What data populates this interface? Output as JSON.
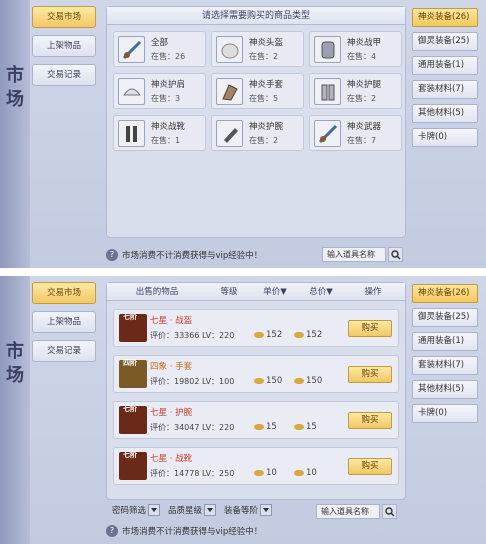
{
  "side_title": [
    "市",
    "场"
  ],
  "nav": [
    "交易市场",
    "上架物品",
    "交易记录"
  ],
  "categories": [
    "神炎装备(26)",
    "御灵装备(25)",
    "通用装备(1)",
    "套装材料(7)",
    "其他材料(5)",
    "卡牌(0)"
  ],
  "top": {
    "header": "请选择需要购买的商品类型",
    "items": [
      {
        "name": "全部",
        "stock": "在售：26"
      },
      {
        "name": "神炎头盔",
        "stock": "在售：2"
      },
      {
        "name": "神炎战甲",
        "stock": "在售：4"
      },
      {
        "name": "神炎护肩",
        "stock": "在售：3"
      },
      {
        "name": "神炎手套",
        "stock": "在售：5"
      },
      {
        "name": "神炎护腿",
        "stock": "在售：2"
      },
      {
        "name": "神炎战靴",
        "stock": "在售：1"
      },
      {
        "name": "神炎护腕",
        "stock": "在售：2"
      },
      {
        "name": "神炎武器",
        "stock": "在售：7"
      }
    ],
    "footer": "市场消费不计消费获得与vip经验中！",
    "search_placeholder": "输入道具名称"
  },
  "bottom": {
    "columns": [
      "出售的物品",
      "等级",
      "单价▼",
      "总价▼",
      "操作"
    ],
    "rows": [
      {
        "badge": "七阶",
        "title": "七星 · 战盔",
        "meta": "评价：33366   LV：220",
        "price1": "152",
        "price2": "152",
        "buy": "购买"
      },
      {
        "badge": "四阶",
        "title": "四象 · 手套",
        "meta": "评价：19802   LV：100",
        "price1": "150",
        "price2": "150",
        "buy": "购买"
      },
      {
        "badge": "七阶",
        "title": "七星 · 护腕",
        "meta": "评价：34047   LV：220",
        "price1": "15",
        "price2": "15",
        "buy": "购买"
      },
      {
        "badge": "七阶",
        "title": "七星 · 战靴",
        "meta": "评价：14778   LV：250",
        "price1": "10",
        "price2": "10",
        "buy": "购买"
      }
    ],
    "filters": [
      "密码筛选",
      "品质星级",
      "装备等阶"
    ],
    "search_placeholder": "输入道具名称",
    "footer": "市场消费不计消费获得与vip经验中！"
  },
  "colors": {
    "accent_gold": "#f1c865",
    "red_text": "#d23a2a",
    "orange_text": "#c86a10"
  }
}
